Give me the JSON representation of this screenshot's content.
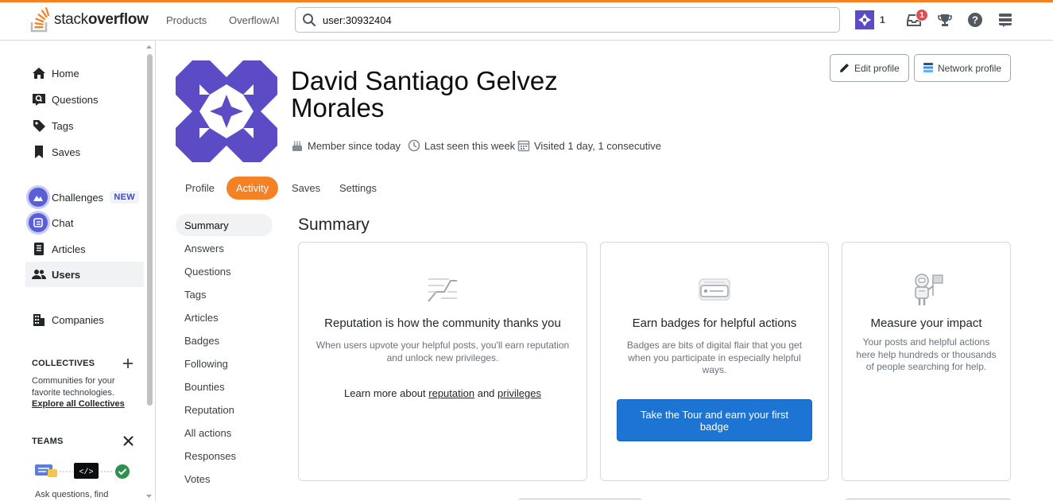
{
  "header": {
    "logo_text_light": "stack",
    "logo_text_bold": "overflow",
    "nav": [
      "Products",
      "OverflowAI"
    ],
    "search_value": "user:30932404",
    "reputation": "1",
    "inbox_count": "1"
  },
  "sidebar": {
    "items": [
      {
        "label": "Home",
        "icon": "home-icon"
      },
      {
        "label": "Questions",
        "icon": "questions-icon"
      },
      {
        "label": "Tags",
        "icon": "tag-icon"
      },
      {
        "label": "Saves",
        "icon": "bookmark-icon"
      },
      {
        "label": "Challenges",
        "icon": "challenges-icon",
        "tag": "NEW"
      },
      {
        "label": "Chat",
        "icon": "chat-icon"
      },
      {
        "label": "Articles",
        "icon": "articles-icon"
      },
      {
        "label": "Users",
        "icon": "users-icon",
        "active": true
      },
      {
        "label": "Companies",
        "icon": "companies-icon"
      }
    ],
    "collectives_heading": "COLLECTIVES",
    "collectives_desc_1": "Communities for your",
    "collectives_desc_2": "favorite technologies.",
    "collectives_link": "Explore all Collectives",
    "teams_heading": "TEAMS",
    "teams_text": "Ask questions, find"
  },
  "profile": {
    "name_line1": "David Santiago Gelvez",
    "name_line2": "Morales",
    "member_since": "Member since today",
    "last_seen": "Last seen this week",
    "visited": "Visited 1 day, 1 consecutive",
    "edit_profile": "Edit profile",
    "network_profile": "Network profile"
  },
  "tabs": [
    {
      "label": "Profile"
    },
    {
      "label": "Activity",
      "active": true
    },
    {
      "label": "Saves"
    },
    {
      "label": "Settings"
    }
  ],
  "activity_nav": [
    "Summary",
    "Answers",
    "Questions",
    "Tags",
    "Articles",
    "Badges",
    "Following",
    "Bounties",
    "Reputation",
    "All actions",
    "Responses",
    "Votes"
  ],
  "summary": {
    "title": "Summary",
    "reputation_card": {
      "title": "Reputation is how the community thanks you",
      "body_1": "When users upvote your helpful posts, you'll earn reputation",
      "body_2": "and unlock new privileges.",
      "learn_prefix": "Learn more about",
      "learn_link1": "reputation",
      "learn_and": "and",
      "learn_link2": "privileges"
    },
    "badges_card": {
      "title": "Earn badges for helpful actions",
      "body_1": "Badges are bits of digital flair that you get",
      "body_2": "when you participate in especially helpful",
      "body_3": "ways.",
      "button": "Take the Tour and earn your first badge"
    },
    "impact_card": {
      "title": "Measure your impact",
      "body_1": "Your posts and helpful actions",
      "body_2": "here help hundreds or thousands",
      "body_3": "of people searching for help."
    }
  },
  "colors": {
    "accent": "#f48225",
    "primary_button": "#1d74d2",
    "avatar": "#5b4bc4"
  }
}
